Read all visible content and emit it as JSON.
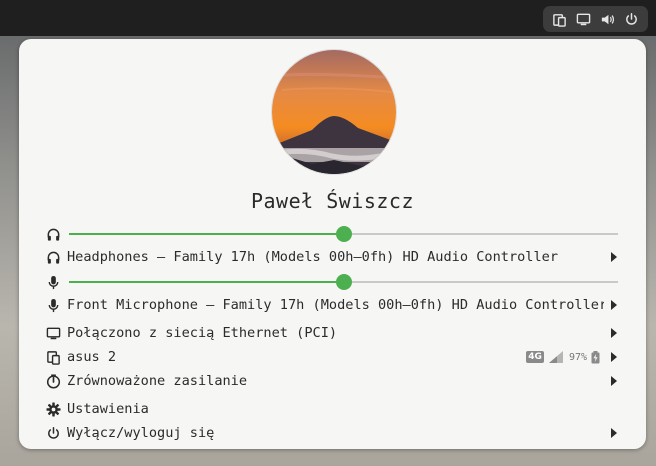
{
  "user": {
    "name": "Paweł Świszcz"
  },
  "audio": {
    "output_volume": 0.5,
    "output_device": "Headphones – Family 17h (Models 00h–0fh) HD Audio Controller",
    "input_volume": 0.5,
    "input_device": "Front Microphone – Family 17h (Models 00h–0fh) HD Audio Controller"
  },
  "network": {
    "label": "Połączono z siecią Ethernet (PCI)"
  },
  "device": {
    "label": "asus 2",
    "network_type": "4G",
    "battery": "97%"
  },
  "power_profile": {
    "label": "Zrównoważone zasilanie"
  },
  "settings": {
    "label": "Ustawienia"
  },
  "power": {
    "label": "Wyłącz/wyloguj się"
  },
  "colors": {
    "accent": "#4caf50",
    "menu_bg": "#f6f6f5",
    "topbar": "#1f1f20"
  },
  "icons": [
    "phone-icon",
    "monitor-icon",
    "speaker-icon",
    "power-icon",
    "headphones-icon",
    "microphone-icon",
    "gauge-icon",
    "gear-icon",
    "chevron-right-icon"
  ]
}
